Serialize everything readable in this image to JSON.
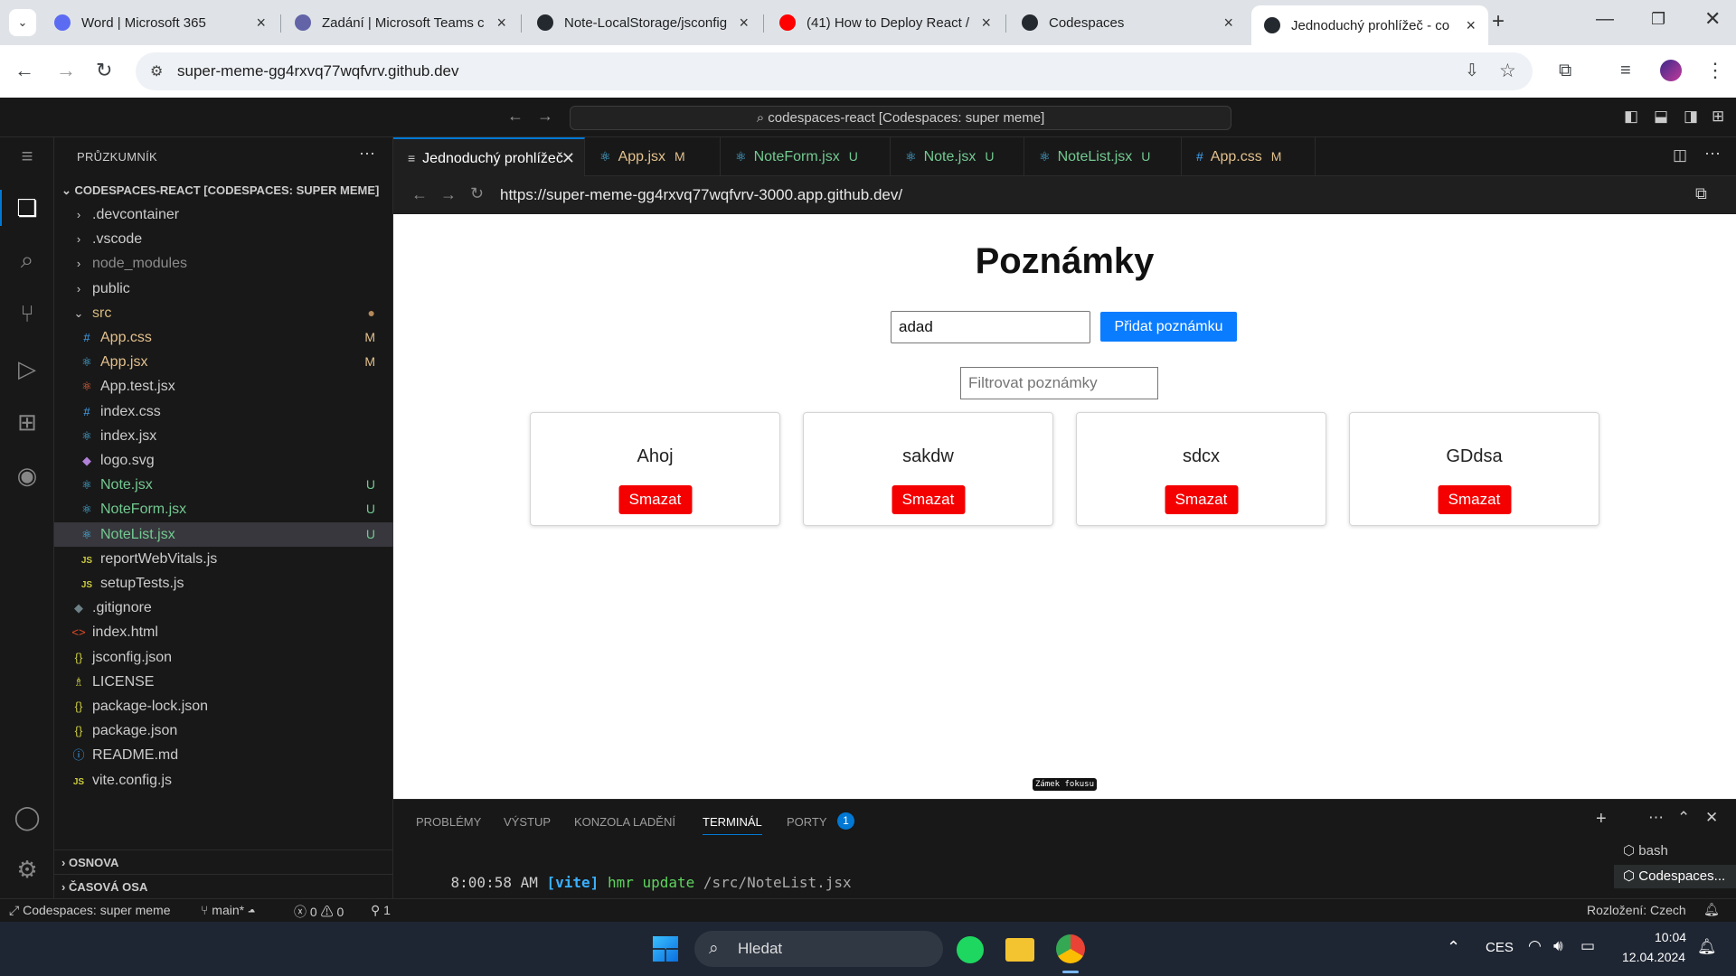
{
  "browser": {
    "tabs": [
      {
        "title": "Word | Microsoft 365",
        "icon": "microsoft-365-icon",
        "color": "#5b6cf2"
      },
      {
        "title": "Zadání | Microsoft Teams c",
        "icon": "teams-icon",
        "color": "#6264a7"
      },
      {
        "title": "Note-LocalStorage/jsconfig",
        "icon": "github-icon",
        "color": "#24292f"
      },
      {
        "title": "(41) How to Deploy React /",
        "icon": "youtube-icon",
        "color": "#ff0000"
      },
      {
        "title": "Codespaces",
        "icon": "github-icon",
        "color": "#24292f"
      },
      {
        "title": "Jednoduchý prohlížeč - co",
        "icon": "github-icon",
        "color": "#24292f"
      }
    ],
    "url": "super-meme-gg4rxvq77wqfvrv.github.dev"
  },
  "vscode": {
    "command_center": "codespaces-react [Codespaces: super meme]",
    "explorer_title": "PRŮZKUMNÍK",
    "workspace": "CODESPACES-REACT [CODESPACES: SUPER MEME]",
    "files": [
      {
        "name": ".devcontainer",
        "type": "folder",
        "badge": "",
        "color": "#cccccc"
      },
      {
        "name": ".vscode",
        "type": "folder",
        "badge": "",
        "color": "#cccccc"
      },
      {
        "name": "node_modules",
        "type": "folder",
        "badge": "",
        "color": "#8c8c8c"
      },
      {
        "name": "public",
        "type": "folder",
        "badge": "",
        "color": "#cccccc"
      },
      {
        "name": "src",
        "type": "folder-open",
        "badge": "●",
        "color": "#d7ba7d"
      },
      {
        "name": "App.css",
        "type": "css",
        "badge": "M",
        "color": "#e2c08d"
      },
      {
        "name": "App.jsx",
        "type": "react",
        "badge": "M",
        "color": "#e2c08d"
      },
      {
        "name": "App.test.jsx",
        "type": "test",
        "badge": "",
        "color": "#cccccc"
      },
      {
        "name": "index.css",
        "type": "css",
        "badge": "",
        "color": "#cccccc"
      },
      {
        "name": "index.jsx",
        "type": "react",
        "badge": "",
        "color": "#cccccc"
      },
      {
        "name": "logo.svg",
        "type": "svg",
        "badge": "",
        "color": "#cccccc"
      },
      {
        "name": "Note.jsx",
        "type": "react",
        "badge": "U",
        "color": "#73c991"
      },
      {
        "name": "NoteForm.jsx",
        "type": "react",
        "badge": "U",
        "color": "#73c991"
      },
      {
        "name": "NoteList.jsx",
        "type": "react",
        "badge": "U",
        "color": "#73c991"
      },
      {
        "name": "reportWebVitals.js",
        "type": "js",
        "badge": "",
        "color": "#cccccc"
      },
      {
        "name": "setupTests.js",
        "type": "js",
        "badge": "",
        "color": "#cccccc"
      },
      {
        "name": ".gitignore",
        "type": "git",
        "badge": "",
        "color": "#cccccc"
      },
      {
        "name": "index.html",
        "type": "html",
        "badge": "",
        "color": "#cccccc"
      },
      {
        "name": "jsconfig.json",
        "type": "json",
        "badge": "",
        "color": "#cccccc"
      },
      {
        "name": "LICENSE",
        "type": "license",
        "badge": "",
        "color": "#cccccc"
      },
      {
        "name": "package-lock.json",
        "type": "json",
        "badge": "",
        "color": "#cccccc"
      },
      {
        "name": "package.json",
        "type": "json",
        "badge": "",
        "color": "#cccccc"
      },
      {
        "name": "README.md",
        "type": "info",
        "badge": "",
        "color": "#cccccc"
      },
      {
        "name": "vite.config.js",
        "type": "js",
        "badge": "",
        "color": "#cccccc"
      }
    ],
    "outline": "OSNOVA",
    "timeline": "ČASOVÁ OSA",
    "editor_tabs": [
      {
        "label": "Jednoduchý prohlížeč",
        "badge": "",
        "color": "#ffffff"
      },
      {
        "label": "App.jsx",
        "badge": "M",
        "color": "#e2c08d"
      },
      {
        "label": "NoteForm.jsx",
        "badge": "U",
        "color": "#73c991"
      },
      {
        "label": "Note.jsx",
        "badge": "U",
        "color": "#73c991"
      },
      {
        "label": "NoteList.jsx",
        "badge": "U",
        "color": "#73c991"
      },
      {
        "label": "App.css",
        "badge": "M",
        "color": "#e2c08d"
      }
    ],
    "preview_url": "https://super-meme-gg4rxvq77wqfvrv-3000.app.github.dev/",
    "focus_lock": "Zámek fokusu",
    "panel_tabs": [
      "PROBLÉMY",
      "VÝSTUP",
      "KONZOLA LADĚNÍ",
      "TERMINÁL",
      "PORTY"
    ],
    "ports_count": "1",
    "terminal": {
      "time": "8:00:58 AM",
      "tag": "[vite]",
      "cmd": "hmr update",
      "path": "/src/NoteList.jsx"
    },
    "terminals": [
      "bash",
      "Codespaces..."
    ],
    "status": {
      "remote": "Codespaces: super meme",
      "branch": "main*",
      "errors": "0",
      "warnings": "0",
      "ports": "1",
      "layout": "Rozložení: Czech"
    }
  },
  "app": {
    "title": "Poznámky",
    "note_input_value": "adad",
    "add_button": "Přidat poznámku",
    "filter_placeholder": "Filtrovat poznámky",
    "notes": [
      "Ahoj",
      "sakdw",
      "sdcx",
      "GDdsa"
    ],
    "delete_label": "Smazat"
  },
  "taskbar": {
    "search": "Hledat",
    "lang": "CES",
    "time": "10:04",
    "date": "12.04.2024"
  }
}
